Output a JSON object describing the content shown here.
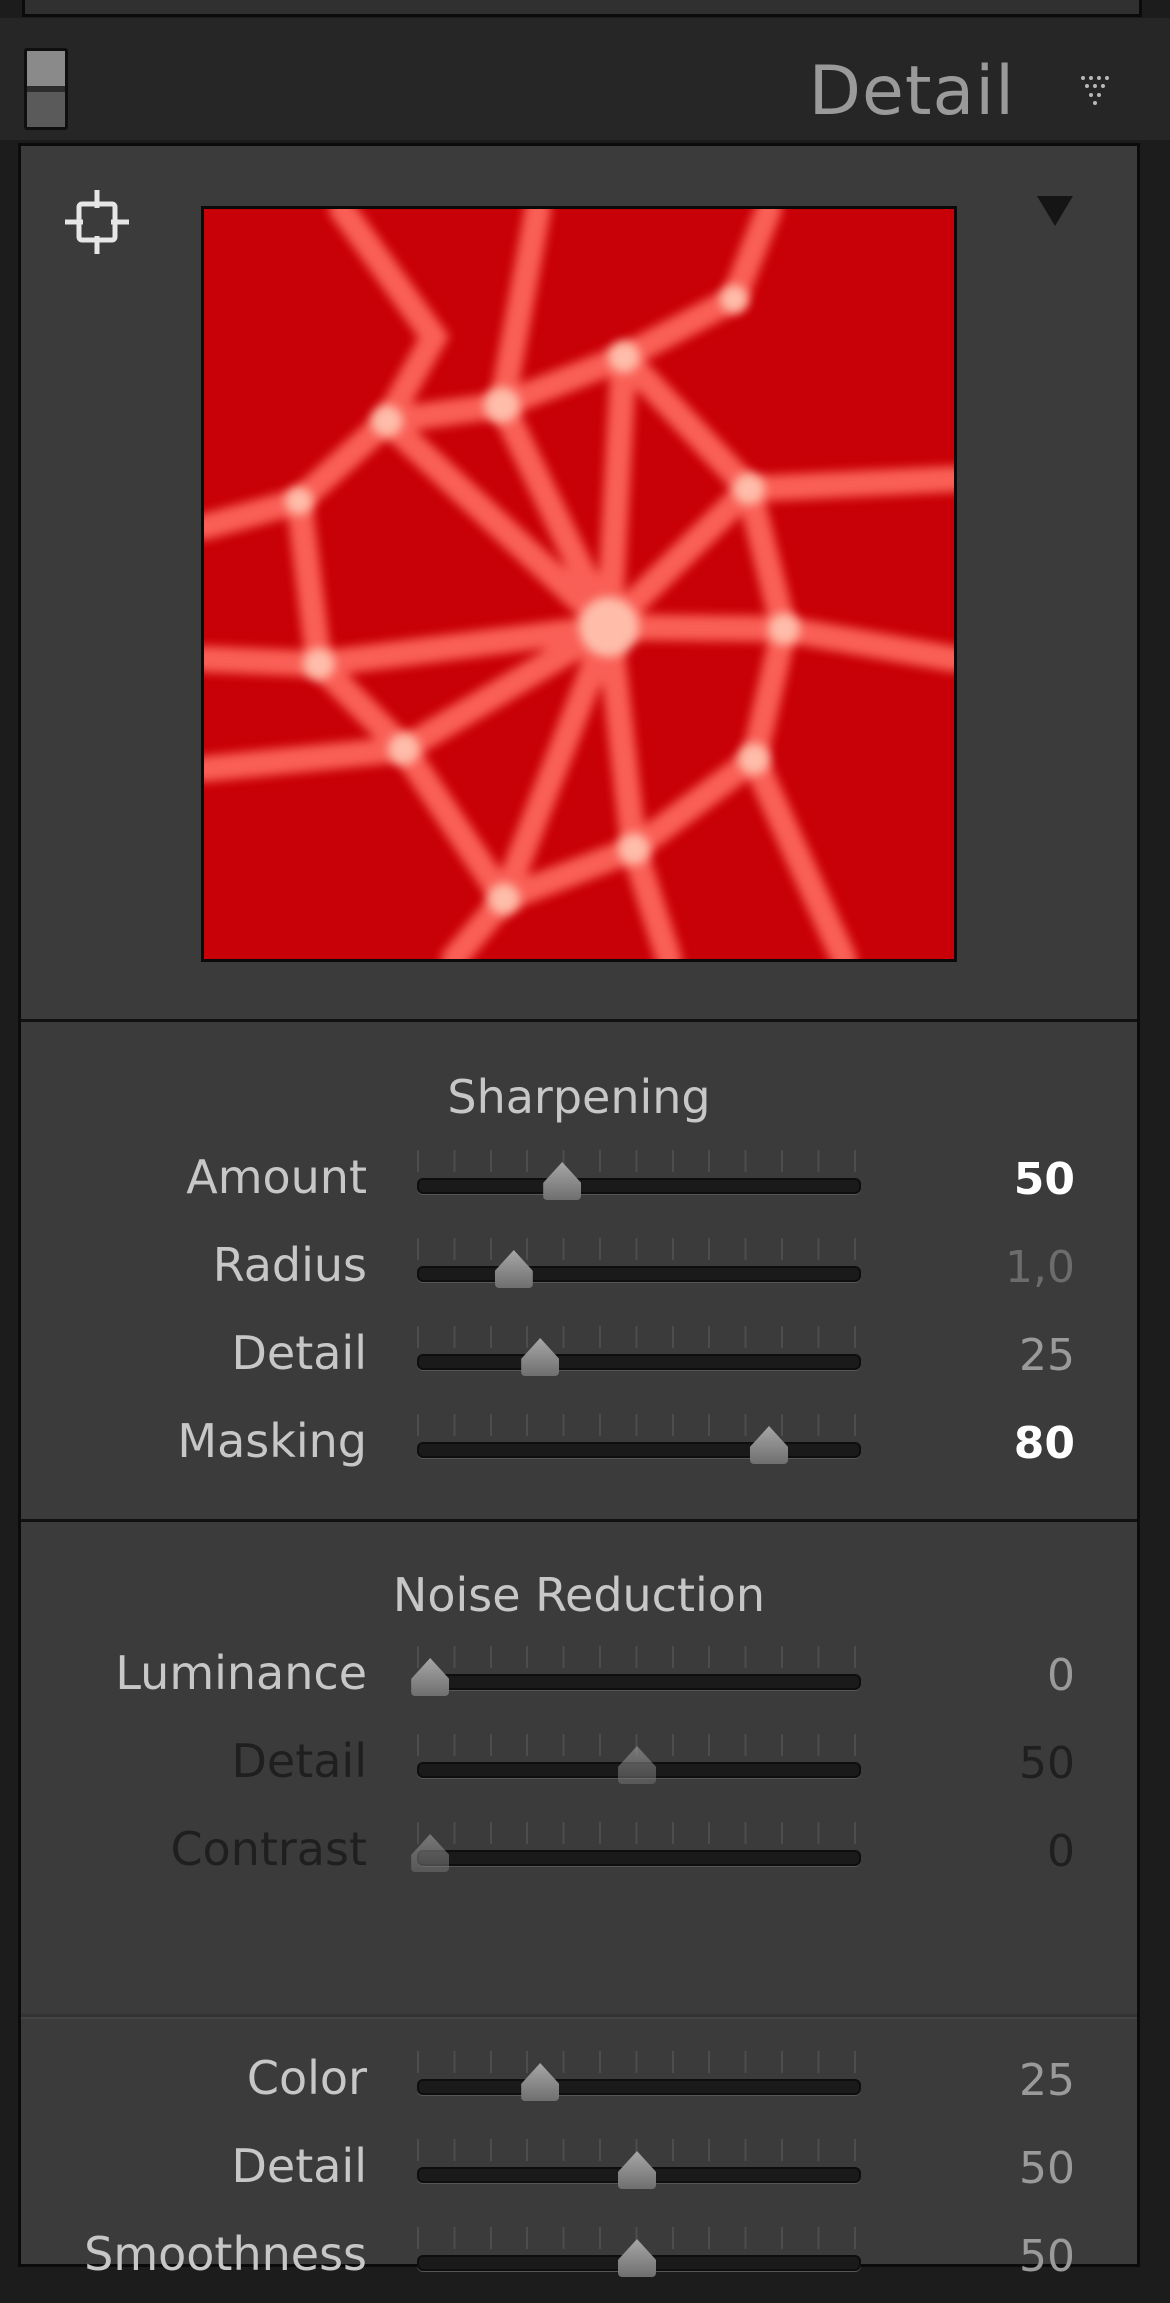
{
  "header": {
    "title": "Detail"
  },
  "colors": {
    "label_active": "#c7c7c7",
    "label_disabled": "#1f1f1f",
    "value_bright": "#ffffff",
    "value_dim": "#9a9a9a",
    "value_disabled": "#1f1f1f",
    "preview_red": "#c80007"
  },
  "sharpening": {
    "heading": "Sharpening",
    "rows": [
      {
        "label": "Amount",
        "value": "50",
        "level": 0.33,
        "state": "bright"
      },
      {
        "label": "Radius",
        "value": "1,0",
        "level": 0.22,
        "state": "dim"
      },
      {
        "label": "Detail",
        "value": "25",
        "level": 0.28,
        "state": "dim-soft"
      },
      {
        "label": "Masking",
        "value": "80",
        "level": 0.8,
        "state": "bright"
      }
    ]
  },
  "noise_reduction": {
    "heading": "Noise Reduction",
    "rows": [
      {
        "label": "Luminance",
        "value": "0",
        "level": 0.03,
        "state": "normal"
      },
      {
        "label": "Detail",
        "value": "50",
        "level": 0.5,
        "state": "disabled"
      },
      {
        "label": "Contrast",
        "value": "0",
        "level": 0.03,
        "state": "disabled"
      },
      {
        "label": "Color",
        "value": "25",
        "level": 0.28,
        "state": "normal"
      },
      {
        "label": "Detail",
        "value": "50",
        "level": 0.5,
        "state": "normal"
      },
      {
        "label": "Smoothness",
        "value": "50",
        "level": 0.5,
        "state": "normal"
      }
    ]
  },
  "icons": {
    "panel_toggle": "panel-switch-icon",
    "collapse": "collapse-triangle-icon",
    "target": "target-adjust-icon",
    "preview_menu": "triangle-down-icon"
  }
}
